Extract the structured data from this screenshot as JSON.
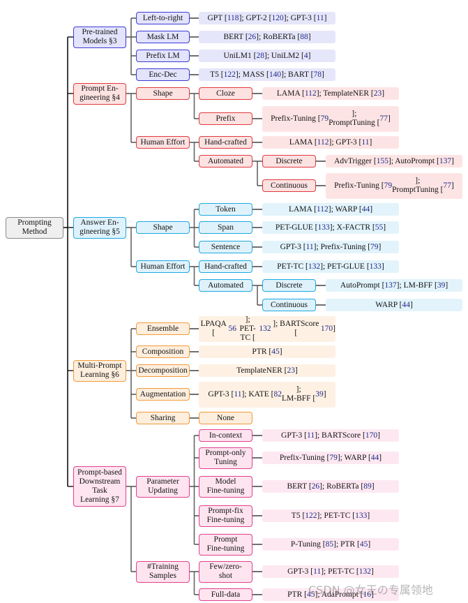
{
  "root": {
    "label": "Prompting\nMethod"
  },
  "themes": {
    "gray": {
      "border": "#8a8a8a",
      "fill": "#efefef",
      "leaf": "#efefef"
    },
    "blue": {
      "border": "#3b3bd6",
      "fill": "#e3e3fb",
      "leaf": "#e6e6fa"
    },
    "red": {
      "border": "#e0393c",
      "fill": "#fde2e2",
      "leaf": "#fde4e4"
    },
    "cyan": {
      "border": "#1ea8e0",
      "fill": "#dff2fb",
      "leaf": "#e2f3fb"
    },
    "orange": {
      "border": "#f29a3a",
      "fill": "#fdeedd",
      "leaf": "#fef1e4"
    },
    "pink": {
      "border": "#e23f8e",
      "fill": "#fde4ef",
      "leaf": "#fde8f1"
    }
  },
  "branches": [
    {
      "label": "Pre-trained\nModels §3",
      "theme": "blue",
      "children": [
        {
          "label": "Left-to-right",
          "leaf": "GPT [118]; GPT-2 [120]; GPT-3 [11]"
        },
        {
          "label": "Mask LM",
          "leaf": "BERT [26]; RoBERTa [88]"
        },
        {
          "label": "Prefix LM",
          "leaf": "UniLM1 [28]; UniLM2 [4]"
        },
        {
          "label": "Enc-Dec",
          "leaf": "T5 [122]; MASS [140]; BART [78]"
        }
      ]
    },
    {
      "label": "Prompt En-\ngineering §4",
      "theme": "red",
      "children": [
        {
          "label": "Shape",
          "children": [
            {
              "label": "Cloze",
              "leaf": "LAMA [112]; TemplateNER [23]"
            },
            {
              "label": "Prefix",
              "leaf": "Prefix-Tuning [79];\nPromptTuning [77]"
            }
          ]
        },
        {
          "label": "Human Effort",
          "children": [
            {
              "label": "Hand-crafted",
              "leaf": "LAMA [112]; GPT-3 [11]"
            },
            {
              "label": "Automated",
              "children": [
                {
                  "label": "Discrete",
                  "leaf": "AdvTrigger [155]; AutoPrompt [137]"
                },
                {
                  "label": "Continuous",
                  "leaf": "Prefix-Tuning [79];\nPromptTuning [77]"
                }
              ]
            }
          ]
        }
      ]
    },
    {
      "label": "Answer En-\ngineering §5",
      "theme": "cyan",
      "children": [
        {
          "label": "Shape",
          "children": [
            {
              "label": "Token",
              "leaf": "LAMA [112]; WARP [44]"
            },
            {
              "label": "Span",
              "leaf": "PET-GLUE [133]; X-FACTR [55]"
            },
            {
              "label": "Sentence",
              "leaf": "GPT-3 [11]; Prefix-Tuning [79]"
            }
          ]
        },
        {
          "label": "Human Effort",
          "children": [
            {
              "label": "Hand-crafted",
              "leaf": "PET-TC [132]; PET-GLUE [133]"
            },
            {
              "label": "Automated",
              "children": [
                {
                  "label": "Discrete",
                  "leaf": "AutoPrompt [137]; LM-BFF [39]"
                },
                {
                  "label": "Continuous",
                  "leaf": "WARP [44]"
                }
              ]
            }
          ]
        }
      ]
    },
    {
      "label": "Multi-Prompt\nLearning §6",
      "theme": "orange",
      "children": [
        {
          "label": "Ensemble",
          "leaf": "LPAQA [56]; PET-\nTC [132]; BARTScore [170]"
        },
        {
          "label": "Composition",
          "leaf": "PTR [45]"
        },
        {
          "label": "Decomposition",
          "leaf": "TemplateNER [23]"
        },
        {
          "label": "Augmentation",
          "leaf": "GPT-3 [11]; KATE [82];\nLM-BFF [39]"
        },
        {
          "label": "Sharing",
          "leaf_box": "None"
        }
      ]
    },
    {
      "label": "Prompt-based\nDownstream\nTask\nLearning §7",
      "theme": "pink",
      "children": [
        {
          "label": "Parameter\nUpdating",
          "children": [
            {
              "label": "In-context",
              "leaf": "GPT-3 [11]; BARTScore [170]"
            },
            {
              "label": "Prompt-only\nTuning",
              "leaf": "Prefix-Tuning [79]; WARP [44]"
            },
            {
              "label": "Model\nFine-tuning",
              "leaf": "BERT [26]; RoBERTa [89]"
            },
            {
              "label": "Prompt-fix\nFine-tuning",
              "leaf": "T5 [122]; PET-TC [133]"
            },
            {
              "label": "Prompt\nFine-tuning",
              "leaf": "P-Tuning [85]; PTR [45]"
            }
          ]
        },
        {
          "label": "#Training\nSamples",
          "children": [
            {
              "label": "Few/zero-\nshot",
              "leaf": "GPT-3 [11]; PET-TC [132]"
            },
            {
              "label": "Full-data",
              "leaf": "PTR [45]; AdaPrompt [16]"
            }
          ]
        }
      ]
    }
  ],
  "watermark": "CSDN @女王の专属领地"
}
